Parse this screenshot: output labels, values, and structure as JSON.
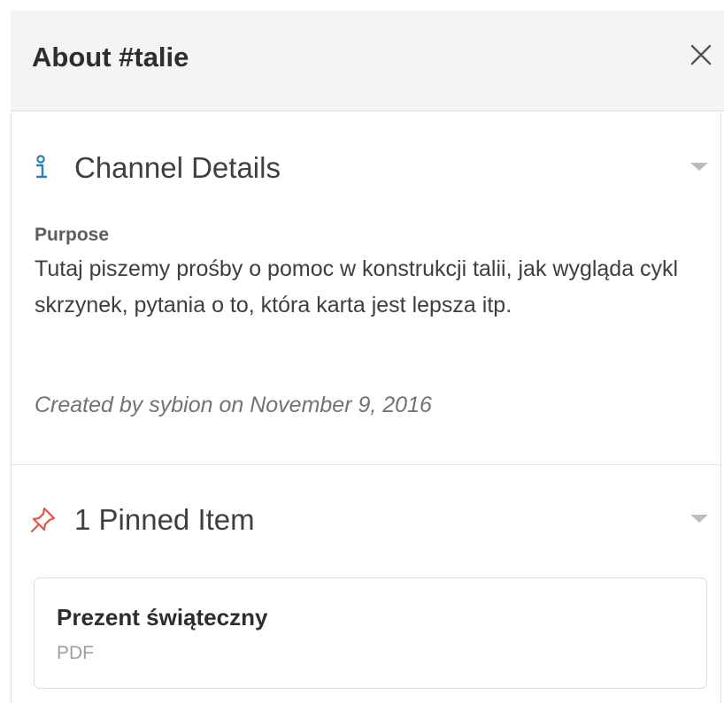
{
  "header": {
    "title": "About #talie",
    "close_icon": "close-icon"
  },
  "channel_details": {
    "title": "Channel Details",
    "icon": "info-icon",
    "icon_color": "#2a80b9",
    "purpose_label": "Purpose",
    "purpose_text": "Tutaj piszemy prośby o pomoc w konstrukcji talii, jak wygląda cykl skrzynek, pytania o to, która karta jest lepsza itp.",
    "created_by": "Created by sybion on November 9, 2016"
  },
  "pinned": {
    "title": "1 Pinned Item",
    "icon": "pin-icon",
    "icon_color": "#e0564b",
    "items": [
      {
        "title": "Prezent świąteczny",
        "type": "PDF"
      }
    ]
  }
}
